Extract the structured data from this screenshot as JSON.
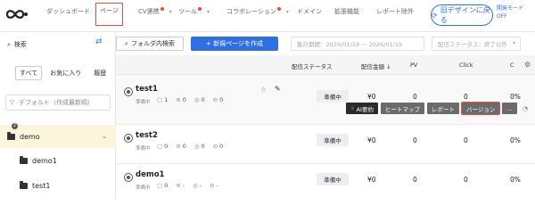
{
  "nav": {
    "items": [
      {
        "label": "ダッシュボード"
      },
      {
        "label": "ページ"
      },
      {
        "label": "CV連携"
      },
      {
        "label": "ツール"
      },
      {
        "label": "コラボレーション"
      },
      {
        "label": "ドメイン"
      },
      {
        "label": "拡張機能"
      },
      {
        "label": "レポート除外"
      }
    ],
    "old_design": "旧デザインに戻る",
    "dev_mode_line1": "開発モード",
    "dev_mode_line2": "OFF"
  },
  "sidebar": {
    "search_label": "検索",
    "tabs": [
      {
        "label": "すべて"
      },
      {
        "label": "お気に入り"
      },
      {
        "label": "履歴"
      }
    ],
    "sort_value": "デフォルト（作成最新順）",
    "folders": [
      {
        "label": "demo",
        "badge": "2"
      },
      {
        "label": "demo1"
      },
      {
        "label": "test1"
      }
    ]
  },
  "toolbar": {
    "folder_search": "フォルダ内検索",
    "new_page": "+ 新規ページを作成",
    "date_range": "集計期間：2026/01/19 ～ 2026/01/19",
    "status_filter": "配信ステータス：終了以外"
  },
  "table": {
    "headers": {
      "status": "配信ステータス",
      "amount": "配信金額 ↓",
      "pv": "PV",
      "click": "Click",
      "c": "C"
    },
    "rows": [
      {
        "name": "test1",
        "sub": "準備中",
        "m1": "1",
        "m2": "0",
        "m3": "0",
        "m4": "0",
        "status": "準備中",
        "amount": "¥0",
        "pv": "0",
        "click": "0",
        "rate": "0%"
      },
      {
        "name": "test2",
        "sub": "準備中",
        "m1": "0",
        "m2": "0",
        "m3": "0",
        "m4": "0",
        "status": "準備中",
        "amount": "¥0",
        "pv": "0",
        "click": "0",
        "rate": "0%"
      },
      {
        "name": "demo1",
        "sub": "準備中",
        "m1": "0",
        "m2": "-",
        "m3": "-",
        "m4": "-",
        "status": "準備中",
        "amount": "¥0",
        "pv": "0",
        "click": "0",
        "rate": "0%"
      }
    ],
    "hover_actions": [
      "AI要約",
      "ヒートマップ",
      "レポート",
      "バージョン",
      "..."
    ]
  }
}
